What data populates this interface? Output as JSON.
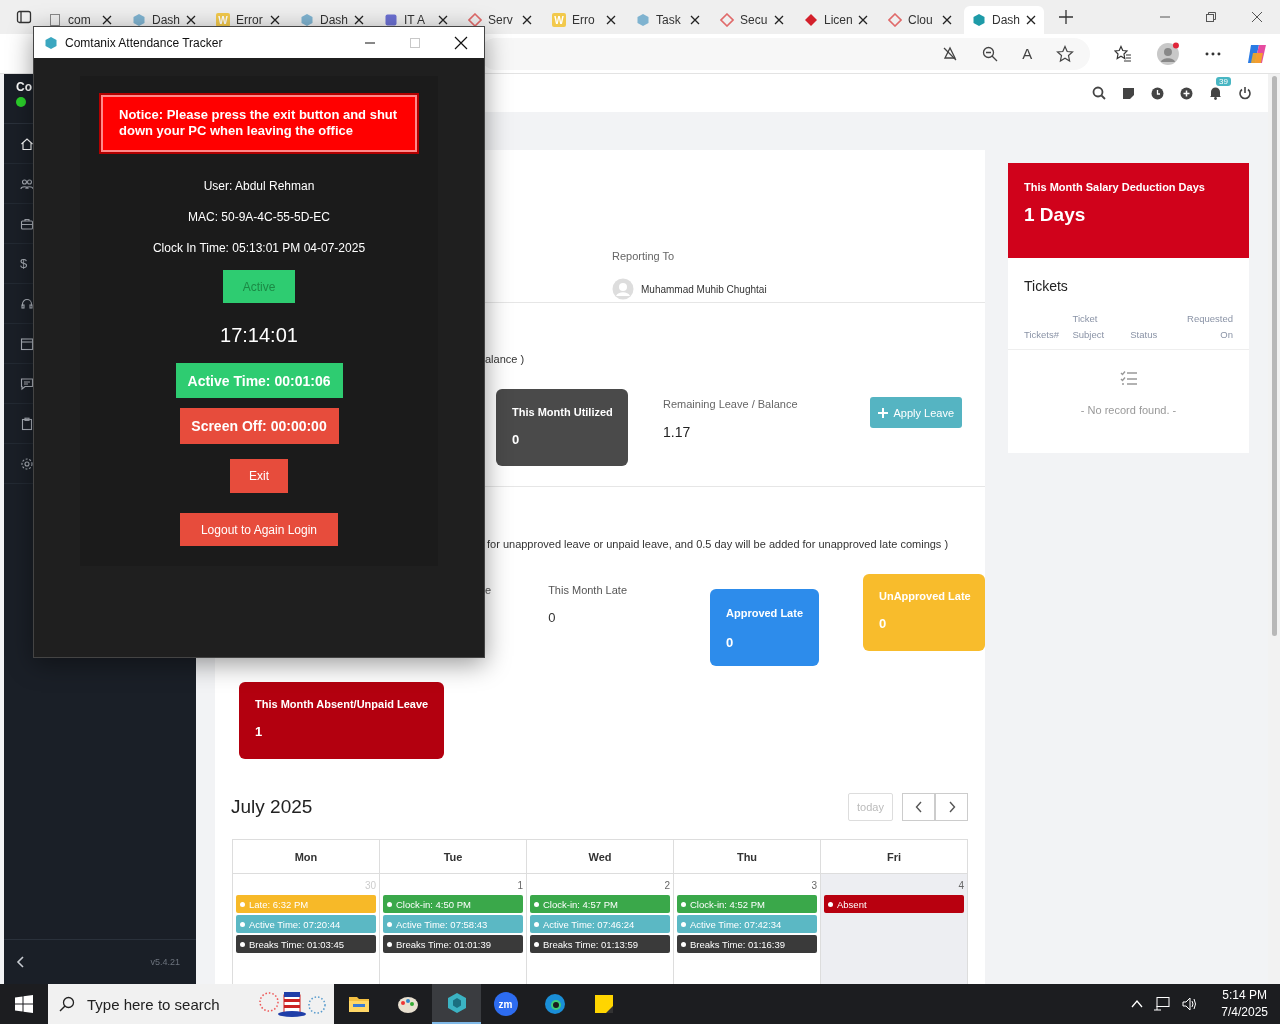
{
  "browser": {
    "tabs": [
      {
        "title": "com",
        "kind": "doc",
        "selected": false
      },
      {
        "title": "Dash",
        "kind": "hex",
        "selected": false
      },
      {
        "title": "Error",
        "kind": "letter",
        "icon_letter": "W",
        "selected": false
      },
      {
        "title": "Dash",
        "kind": "hex",
        "selected": false
      },
      {
        "title": "IT A",
        "kind": "form",
        "selected": false
      },
      {
        "title": "Serv",
        "kind": "diamond",
        "selected": false
      },
      {
        "title": "Erro",
        "kind": "letter",
        "icon_letter": "W",
        "selected": false
      },
      {
        "title": "Task",
        "kind": "hex",
        "selected": false
      },
      {
        "title": "Secu",
        "kind": "diamond",
        "selected": false
      },
      {
        "title": "Licen",
        "kind": "solid",
        "selected": false
      },
      {
        "title": "Clou",
        "kind": "diamond",
        "selected": false
      },
      {
        "title": "Dash",
        "kind": "teal",
        "selected": true
      }
    ],
    "read_aloud_label": "A"
  },
  "sidebar": {
    "brand": "Co",
    "items": [
      {
        "kind": "home",
        "selected": true
      },
      {
        "kind": "users",
        "selected": false
      },
      {
        "kind": "briefcase",
        "selected": false
      },
      {
        "kind": "dollar",
        "glyph": "$",
        "selected": false
      },
      {
        "kind": "headset",
        "selected": false
      },
      {
        "kind": "calendar",
        "selected": false
      },
      {
        "kind": "chat",
        "selected": false
      },
      {
        "kind": "clipboard",
        "selected": false
      },
      {
        "kind": "gear",
        "selected": false
      }
    ],
    "version": "v5.4.21"
  },
  "header": {
    "notification_count": "39"
  },
  "profile": {
    "reporting_to_label": "Reporting To",
    "manager": "Muhammad Muhib Chughtai"
  },
  "leave": {
    "note_fragment": "alance )",
    "utilized": {
      "label": "This Month Utilized",
      "value": "0"
    },
    "remaining": {
      "label": "Remaining Leave / Balance",
      "value": "1.17"
    },
    "apply_button": "Apply Leave"
  },
  "late": {
    "note_fragment": "for unapproved leave or unpaid leave, and 0.5 day will be added for unapproved late comings )",
    "label_fragment": "e",
    "cards": [
      {
        "kind": "plain",
        "label": "This Month Late",
        "value": "0"
      },
      {
        "kind": "info",
        "label": "Approved Late",
        "value": "0"
      },
      {
        "kind": "warning",
        "label": "UnApproved Late",
        "value": "0"
      }
    ],
    "absent": {
      "kind": "danger",
      "label": "This Month Absent/Unpaid Leave",
      "value": "1"
    }
  },
  "calendar": {
    "title": "July 2025",
    "today_button": "today",
    "days": [
      "Mon",
      "Tue",
      "Wed",
      "Thu",
      "Fri"
    ],
    "cells": [
      {
        "date": "30",
        "other_month": true,
        "today": false,
        "events": [
          {
            "kind": "late",
            "text": "Late: 6:32 PM"
          },
          {
            "kind": "active",
            "text": "Active Time: 07:20:44"
          },
          {
            "kind": "breaks",
            "text": "Breaks Time: 01:03:45"
          }
        ]
      },
      {
        "date": "1",
        "other_month": false,
        "today": false,
        "events": [
          {
            "kind": "clockin",
            "text": "Clock-in: 4:50 PM"
          },
          {
            "kind": "active",
            "text": "Active Time: 07:58:43"
          },
          {
            "kind": "breaks",
            "text": "Breaks Time: 01:01:39"
          }
        ]
      },
      {
        "date": "2",
        "other_month": false,
        "today": false,
        "events": [
          {
            "kind": "clockin",
            "text": "Clock-in: 4:57 PM"
          },
          {
            "kind": "active",
            "text": "Active Time: 07:46:24"
          },
          {
            "kind": "breaks",
            "text": "Breaks Time: 01:13:59"
          }
        ]
      },
      {
        "date": "3",
        "other_month": false,
        "today": false,
        "events": [
          {
            "kind": "clockin",
            "text": "Clock-in: 4:52 PM"
          },
          {
            "kind": "active",
            "text": "Active Time: 07:42:34"
          },
          {
            "kind": "breaks",
            "text": "Breaks Time: 01:16:39"
          }
        ]
      },
      {
        "date": "4",
        "other_month": false,
        "today": true,
        "events": [
          {
            "kind": "absent",
            "text": "Absent"
          }
        ]
      }
    ]
  },
  "deduction": {
    "label": "This Month Salary Deduction Days",
    "value": "1 Days"
  },
  "tickets": {
    "title": "Tickets",
    "columns": [
      "Tickets#",
      "Ticket Subject",
      "Status",
      "Requested On"
    ],
    "empty": "- No record found. -"
  },
  "tracker": {
    "title": "Comtanix Attendance Tracker",
    "maximize_disabled": true,
    "notice": "Notice: Please press the exit button and shut down your PC when leaving the office",
    "user": "User: Abdul Rehman",
    "mac": "MAC: 50-9A-4C-55-5D-EC",
    "clock_in": "Clock In Time: 05:13:01 PM 04-07-2025",
    "status": "Active",
    "clock": "17:14:01",
    "active_time": "Active Time: 00:01:06",
    "screen_off": "Screen Off: 00:00:00",
    "exit_button": "Exit",
    "logout_button": "Logout to Again Login"
  },
  "taskbar": {
    "search_placeholder": "Type here to search",
    "apps": [
      {
        "kind": "folder",
        "selected": false
      },
      {
        "kind": "paint",
        "selected": false
      },
      {
        "kind": "hex",
        "selected": true
      },
      {
        "kind": "zoom",
        "label": "zm",
        "selected": false
      },
      {
        "kind": "edge",
        "selected": false
      },
      {
        "kind": "notes",
        "selected": false
      }
    ],
    "time": "5:14 PM",
    "date": "7/4/2025"
  }
}
